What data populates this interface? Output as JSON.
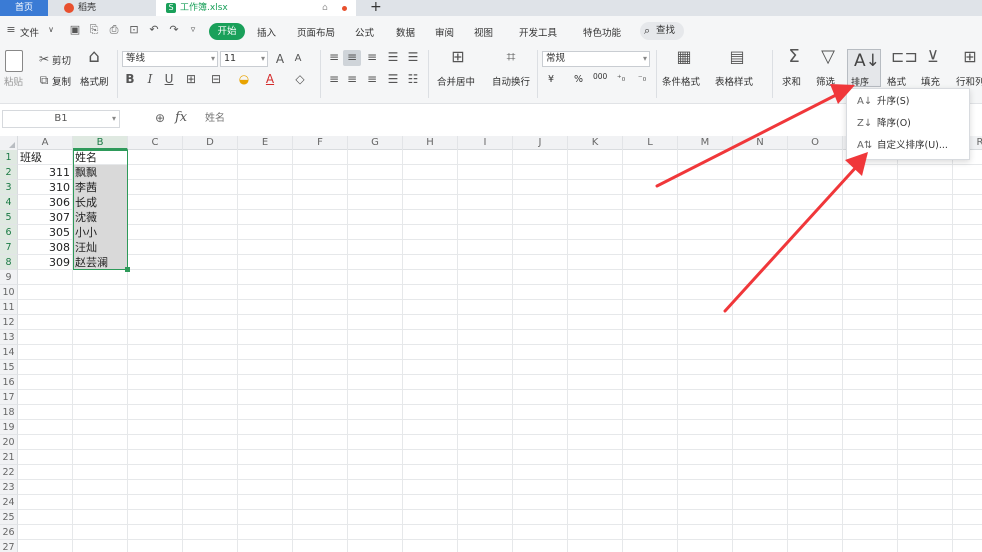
{
  "tabs": {
    "home": "首页",
    "daohang": "稻壳",
    "workbook": "工作簿.xlsx"
  },
  "menu": {
    "file": "文件",
    "items": [
      "开始",
      "插入",
      "页面布局",
      "公式",
      "数据",
      "审阅",
      "视图",
      "开发工具",
      "特色功能"
    ],
    "search": "查找"
  },
  "ribbon": {
    "paste": "粘贴",
    "cut": "剪切",
    "copy": "复制",
    "format_painter": "格式刷",
    "font_name": "等线",
    "font_size": "11",
    "bold": "B",
    "italic": "I",
    "underline": "U",
    "merge": "合并居中",
    "wrap": "自动换行",
    "number_format": "常规",
    "currency": "¥",
    "percent": "%",
    "thousands": "000",
    "cond_format": "条件格式",
    "table_style": "表格样式",
    "sum": "求和",
    "filter": "筛选",
    "sort": "排序",
    "format": "格式",
    "fill": "填充",
    "row_col": "行和列"
  },
  "formula_bar": {
    "cell_ref": "B1",
    "fx": "fx",
    "content": "姓名"
  },
  "grid": {
    "columns": [
      "A",
      "B",
      "C",
      "D",
      "E",
      "F",
      "G",
      "H",
      "I",
      "J",
      "K",
      "L",
      "M",
      "N",
      "O",
      "P",
      "Q",
      "R"
    ],
    "rows": [
      "1",
      "2",
      "3",
      "4",
      "5",
      "6",
      "7",
      "8",
      "9",
      "10",
      "11",
      "12",
      "13",
      "14",
      "15",
      "16",
      "17",
      "18",
      "19",
      "20",
      "21",
      "22",
      "23",
      "24",
      "25",
      "26",
      "27"
    ],
    "data": [
      [
        "班级",
        "姓名"
      ],
      [
        "311",
        "飘飘"
      ],
      [
        "310",
        "李茜"
      ],
      [
        "306",
        "长成"
      ],
      [
        "307",
        "沈薇"
      ],
      [
        "305",
        "小小"
      ],
      [
        "308",
        "汪灿"
      ],
      [
        "309",
        "赵芸澜"
      ]
    ]
  },
  "sort_menu": {
    "ascending": "升序(S)",
    "descending": "降序(O)",
    "custom": "自定义排序(U)..."
  },
  "colors": {
    "accent_green": "#1aa05a",
    "tab_blue": "#3a7bd5",
    "arrow_red": "#f0373a"
  }
}
